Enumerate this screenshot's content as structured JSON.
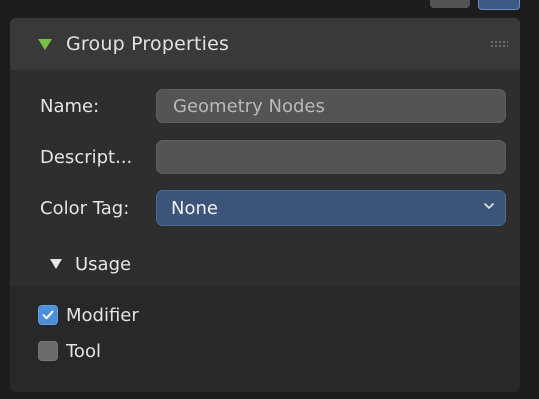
{
  "panel": {
    "title": "Group Properties",
    "header_icon": "triangle-down-icon",
    "grip_icon": "drag-handle-icon"
  },
  "fields": {
    "name": {
      "label": "Name:",
      "value": "Geometry Nodes"
    },
    "description": {
      "label": "Descript...",
      "value": ""
    },
    "color_tag": {
      "label": "Color Tag:",
      "value": "None"
    }
  },
  "usage": {
    "title": "Usage",
    "options": [
      {
        "label": "Modifier",
        "checked": true
      },
      {
        "label": "Tool",
        "checked": false
      }
    ]
  },
  "colors": {
    "accent_green": "#7ac143",
    "select_blue": "#3b5478",
    "checkbox_blue": "#4b90d9"
  }
}
